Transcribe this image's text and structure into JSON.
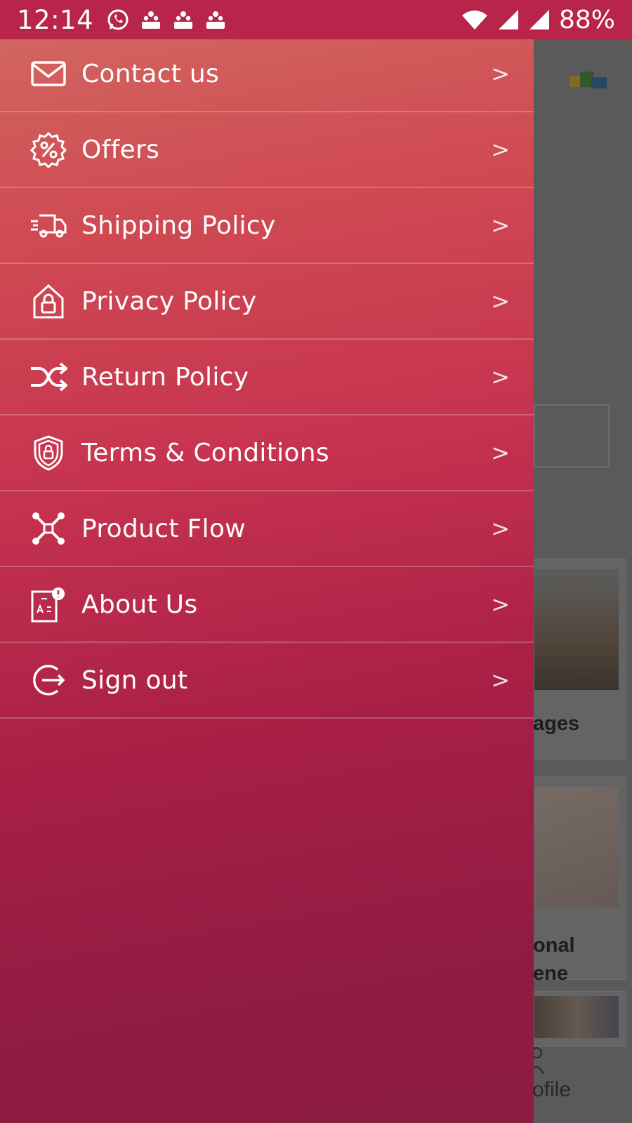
{
  "status_bar": {
    "time": "12:14",
    "battery": "88%",
    "notification_icons": [
      "whatsapp-icon",
      "notification-icon",
      "notification-icon",
      "notification-icon"
    ]
  },
  "drawer": {
    "items": [
      {
        "label": "Contact us",
        "icon": "mail-icon"
      },
      {
        "label": "Offers",
        "icon": "percent-badge-icon"
      },
      {
        "label": "Shipping Policy",
        "icon": "delivery-truck-icon"
      },
      {
        "label": "Privacy Policy",
        "icon": "home-lock-icon"
      },
      {
        "label": "Return Policy",
        "icon": "shuffle-icon"
      },
      {
        "label": "Terms & Conditions",
        "icon": "shield-lock-icon"
      },
      {
        "label": "Product Flow",
        "icon": "network-icon"
      },
      {
        "label": "About Us",
        "icon": "info-card-icon"
      },
      {
        "label": "Sign out",
        "icon": "sign-out-icon"
      }
    ],
    "chevron": ">"
  },
  "background_app": {
    "card1_label": "ages",
    "card2_label_line1": "onal",
    "card2_label_line2": "ene",
    "profile_label": "rofile"
  },
  "colors": {
    "status_bar": "#b8244a",
    "drawer_top": "#d2655f",
    "drawer_bottom": "#8b1c3f"
  }
}
